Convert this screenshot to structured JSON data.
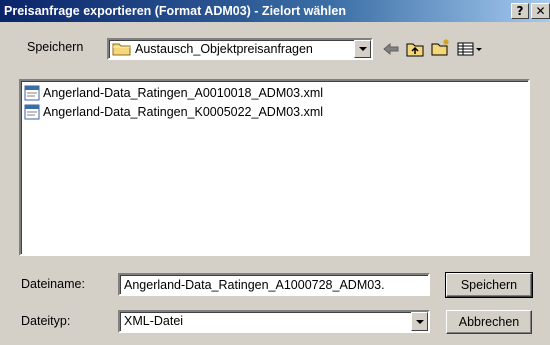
{
  "window": {
    "title": "Preisanfrage exportieren (Format ADM03) - Zielort wählen",
    "help_label": "?",
    "close_label": "✕"
  },
  "save_in": {
    "label": "Speichern",
    "folder": "Austausch_Objektpreisanfragen"
  },
  "toolbar": {
    "icons": [
      "back-arrow-icon",
      "up-folder-icon",
      "new-folder-icon",
      "view-menu-icon"
    ]
  },
  "files": [
    {
      "name": "Angerland-Data_Ratingen_A0010018_ADM03.xml"
    },
    {
      "name": "Angerland-Data_Ratingen_K0005022_ADM03.xml"
    }
  ],
  "filename": {
    "label": "Dateiname:",
    "value": "Angerland-Data_Ratingen_A1000728_ADM03."
  },
  "filetype": {
    "label": "Dateityp:",
    "value": "XML-Datei"
  },
  "buttons": {
    "save": "Speichern",
    "cancel": "Abbrechen"
  }
}
